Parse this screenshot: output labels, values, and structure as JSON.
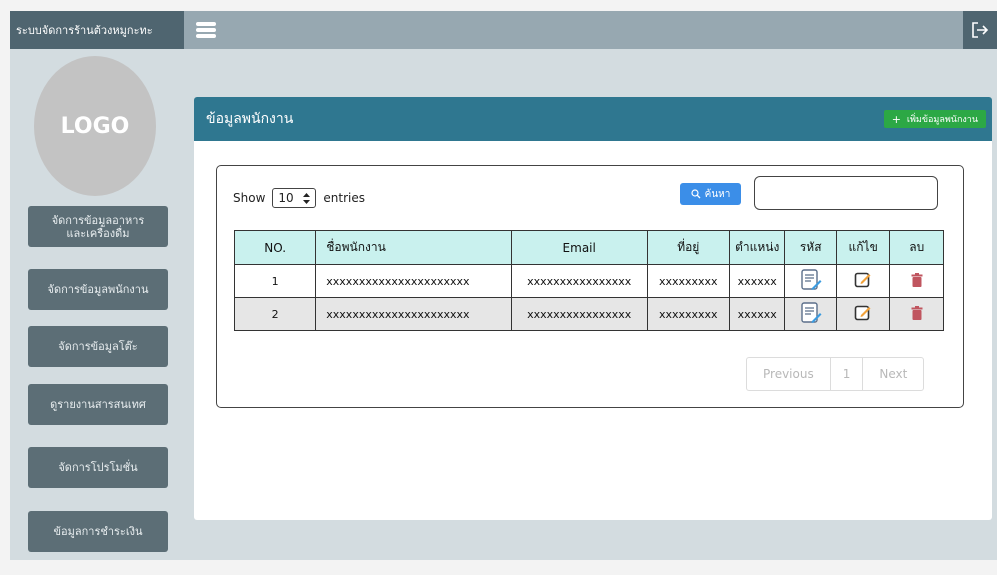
{
  "app": {
    "title": "ระบบจัดการร้านต้วงหมูกะทะ"
  },
  "sidebar": {
    "logo_text": "LOGO",
    "items": [
      {
        "label": "จัดการข้อมูลอาหาร\nและเครื่องดื่ม"
      },
      {
        "label": "จัดการข้อมูลพนักงาน"
      },
      {
        "label": "จัดการข้อมูลโต๊ะ"
      },
      {
        "label": "ดูรายงานสารสนเทศ"
      },
      {
        "label": "จัดการโปรโมชั่น"
      },
      {
        "label": "ข้อมูลการชำระเงิน"
      }
    ]
  },
  "panel": {
    "title": "ข้อมูลพนักงาน",
    "add_button": "เพิ่มข้อมูลพนักงาน"
  },
  "controls": {
    "show_label": "Show",
    "entries_value": "10",
    "entries_label": "entries",
    "search_button": "ค้นหา",
    "search_value": ""
  },
  "table": {
    "headers": [
      "NO.",
      "ชื่อพนักงาน",
      "Email",
      "ที่อยู่",
      "ตำแหน่ง",
      "รหัส",
      "แก้ไข",
      "ลบ"
    ],
    "rows": [
      {
        "no": "1",
        "name": "xxxxxxxxxxxxxxxxxxxxxx",
        "email": "xxxxxxxxxxxxxxxx",
        "address": "xxxxxxxxx",
        "position": "xxxxxx"
      },
      {
        "no": "2",
        "name": "xxxxxxxxxxxxxxxxxxxxxx",
        "email": "xxxxxxxxxxxxxxxx",
        "address": "xxxxxxxxx",
        "position": "xxxxxx"
      }
    ]
  },
  "pagination": {
    "previous": "Previous",
    "page": "1",
    "next": "Next"
  },
  "colors": {
    "header_bar": "#2f7790",
    "add_button": "#2ca845",
    "search_button": "#3b8ee8",
    "table_header": "#c9f1ee",
    "delete_icon": "#c0555f"
  }
}
